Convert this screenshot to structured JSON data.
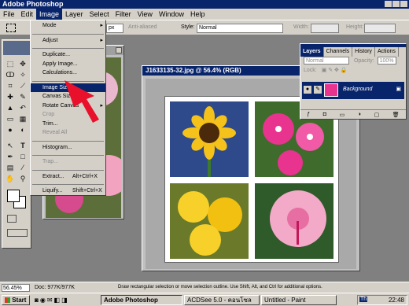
{
  "app": {
    "title": "Adobe Photoshop"
  },
  "menubar": [
    "File",
    "Edit",
    "Image",
    "Layer",
    "Select",
    "Filter",
    "View",
    "Window",
    "Help"
  ],
  "optbar": {
    "antialiased": "Anti-aliased",
    "style_label": "Style:",
    "style_value": "Normal",
    "width_label": "Width:",
    "height_label": "Height:",
    "size_value": "px"
  },
  "image_menu": {
    "mode": "Mode",
    "adjust": "Adjust",
    "duplicate": "Duplicate...",
    "apply_image": "Apply Image...",
    "calculations": "Calculations...",
    "image_size": "Image Size...",
    "canvas_size": "Canvas Size...",
    "rotate_canvas": "Rotate Canvas",
    "crop": "Crop",
    "trim": "Trim...",
    "reveal_all": "Reveal All",
    "histogram": "Histogram...",
    "trap": "Trap...",
    "extract": "Extract...",
    "extract_shortcut": "Alt+Ctrl+X",
    "liquify": "Liquify...",
    "liquify_shortcut": "Shift+Ctrl+X"
  },
  "document": {
    "title": "J1633135-32.jpg @ 56.4% (RGB)"
  },
  "layers_panel": {
    "tabs": [
      "Layers",
      "Channels",
      "History",
      "Actions"
    ],
    "blend_mode": "Normal",
    "opacity_label": "Opacity:",
    "opacity_value": "100%",
    "lock_label": "Lock:",
    "layer_name": "Background"
  },
  "status": {
    "zoom": "56.45%",
    "doc_size": "Doc: 977K/977K",
    "hint": "Draw rectangular selection or move selection outline. Use Shift, Alt, and Ctrl for additional options."
  },
  "taskbar": {
    "start": "Start",
    "tasks": [
      "Adobe Photoshop",
      "ACDSee 5.0 - คอนโซล",
      "Untitled - Paint"
    ],
    "clock": "22:48"
  },
  "colors": {
    "titlebar": "#08246b",
    "chrome": "#d4d0c8",
    "workspace": "#808080",
    "pointer_arrow": "#e8102a"
  }
}
